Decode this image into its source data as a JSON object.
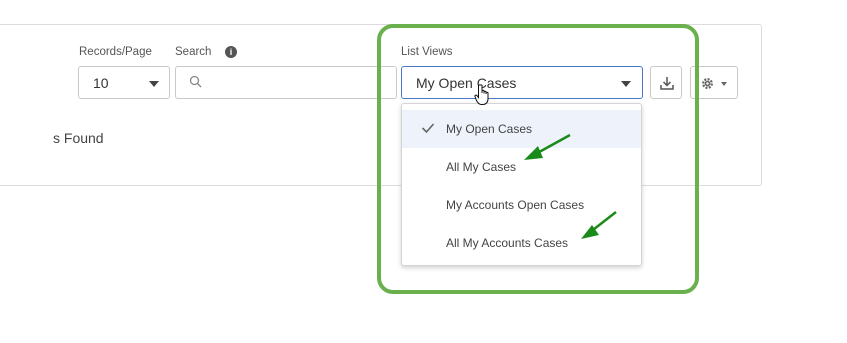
{
  "toolbar": {
    "records_label": "Records/Page",
    "records_value": "10",
    "search_label": "Search",
    "search_placeholder": "",
    "list_views_label": "List Views",
    "list_views_value": "My Open Cases"
  },
  "results": {
    "found_text": "s Found"
  },
  "list_views_menu": {
    "items": [
      {
        "label": "My Open Cases",
        "selected": true
      },
      {
        "label": "All My Cases",
        "selected": false
      },
      {
        "label": "My Accounts Open Cases",
        "selected": false
      },
      {
        "label": "All My Accounts Cases",
        "selected": false
      }
    ]
  },
  "icons": {
    "search": "search-icon",
    "info": "info-icon",
    "download": "download-icon",
    "settings": "gear-icon",
    "check": "checkmark-icon",
    "cursor": "hand-pointer-icon",
    "annotation_arrow": "arrow-icon"
  },
  "colors": {
    "highlight_border": "#6ab04c",
    "annotation_arrow": "#1a8a1a",
    "selected_row": "#eef2fb",
    "focus_border": "#4a78c8"
  }
}
